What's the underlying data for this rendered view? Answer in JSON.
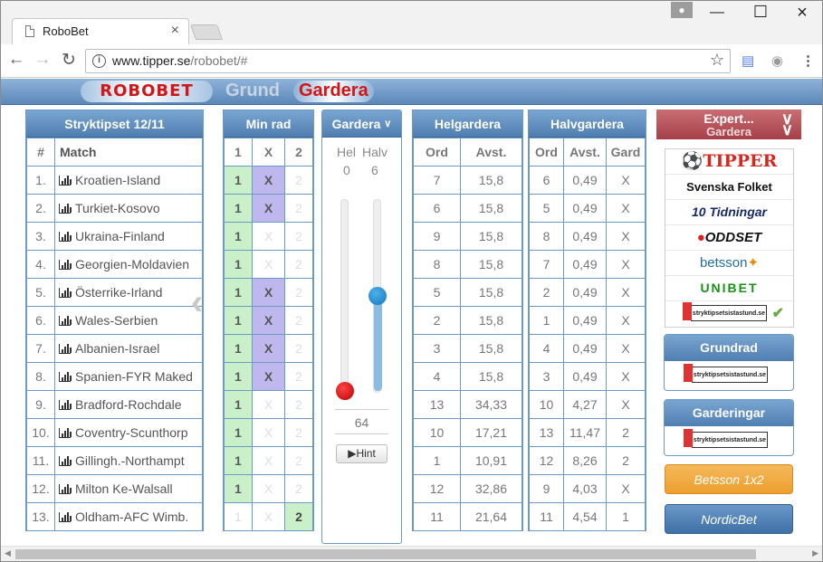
{
  "browser": {
    "tab_title": "RoboBet",
    "url_host": "www.tipper.se",
    "url_path": "/robobet/#"
  },
  "appnav": {
    "logo": "ROBOBET",
    "grund": "Grund",
    "gardera": "Gardera"
  },
  "matches": {
    "title": "Stryktipset 12/11",
    "col_num": "#",
    "col_match": "Match",
    "rows": [
      {
        "n": "1.",
        "name": "Kroatien-Island"
      },
      {
        "n": "2.",
        "name": "Turkiet-Kosovo"
      },
      {
        "n": "3.",
        "name": "Ukraina-Finland"
      },
      {
        "n": "4.",
        "name": "Georgien-Moldavien"
      },
      {
        "n": "5.",
        "name": "Österrike-Irland"
      },
      {
        "n": "6.",
        "name": "Wales-Serbien"
      },
      {
        "n": "7.",
        "name": "Albanien-Israel"
      },
      {
        "n": "8.",
        "name": "Spanien-FYR Maked"
      },
      {
        "n": "9.",
        "name": "Bradford-Rochdale"
      },
      {
        "n": "10.",
        "name": "Coventry-Scunthorp"
      },
      {
        "n": "11.",
        "name": "Gillingh.-Northampt"
      },
      {
        "n": "12.",
        "name": "Milton Ke-Walsall"
      },
      {
        "n": "13.",
        "name": "Oldham-AFC Wimb."
      }
    ]
  },
  "minrad": {
    "title": "Min rad",
    "cols": [
      "1",
      "X",
      "2"
    ],
    "rows": [
      [
        "1",
        "X",
        "2"
      ],
      [
        "1",
        "X",
        "2"
      ],
      [
        "1",
        "X",
        "2"
      ],
      [
        "1",
        "X",
        "2"
      ],
      [
        "1",
        "X",
        "2"
      ],
      [
        "1",
        "X",
        "2"
      ],
      [
        "1",
        "X",
        "2"
      ],
      [
        "1",
        "X",
        "2"
      ],
      [
        "1",
        "X",
        "2"
      ],
      [
        "1",
        "X",
        "2"
      ],
      [
        "1",
        "X",
        "2"
      ],
      [
        "1",
        "X",
        "2"
      ],
      [
        "1",
        "X",
        "2"
      ]
    ],
    "selected": [
      [
        true,
        true,
        false
      ],
      [
        true,
        true,
        false
      ],
      [
        true,
        false,
        false
      ],
      [
        true,
        false,
        false
      ],
      [
        true,
        true,
        false
      ],
      [
        true,
        true,
        false
      ],
      [
        true,
        true,
        false
      ],
      [
        true,
        true,
        false
      ],
      [
        true,
        false,
        false
      ],
      [
        true,
        false,
        false
      ],
      [
        true,
        false,
        false
      ],
      [
        true,
        false,
        false
      ],
      [
        false,
        false,
        true
      ]
    ]
  },
  "gardera": {
    "title": "Gardera",
    "hel_label": "Hel",
    "halv_label": "Halv",
    "hel_value": "0",
    "halv_value": "6",
    "rows_count": "64",
    "hint_label": "Hint",
    "hel_level": 0.0,
    "halv_level": 0.5
  },
  "helgardera": {
    "title": "Helgardera",
    "col_ord": "Ord",
    "col_avst": "Avst.",
    "rows": [
      [
        "7",
        "15,8"
      ],
      [
        "6",
        "15,8"
      ],
      [
        "9",
        "15,8"
      ],
      [
        "8",
        "15,8"
      ],
      [
        "5",
        "15,8"
      ],
      [
        "2",
        "15,8"
      ],
      [
        "3",
        "15,8"
      ],
      [
        "4",
        "15,8"
      ],
      [
        "13",
        "34,33"
      ],
      [
        "10",
        "17,21"
      ],
      [
        "1",
        "10,91"
      ],
      [
        "12",
        "32,86"
      ],
      [
        "11",
        "21,64"
      ]
    ]
  },
  "halvgardera": {
    "title": "Halvgardera",
    "col_ord": "Ord",
    "col_avst": "Avst.",
    "col_gard": "Gard",
    "rows": [
      [
        "6",
        "0,49",
        "X"
      ],
      [
        "5",
        "0,49",
        "X"
      ],
      [
        "8",
        "0,49",
        "X"
      ],
      [
        "7",
        "0,49",
        "X"
      ],
      [
        "2",
        "0,49",
        "X"
      ],
      [
        "1",
        "0,49",
        "X"
      ],
      [
        "4",
        "0,49",
        "X"
      ],
      [
        "3",
        "0,49",
        "X"
      ],
      [
        "10",
        "4,27",
        "X"
      ],
      [
        "13",
        "11,47",
        "2"
      ],
      [
        "12",
        "8,26",
        "2"
      ],
      [
        "9",
        "4,03",
        "X"
      ],
      [
        "11",
        "4,54",
        "1"
      ]
    ]
  },
  "expert": {
    "line1": "Expert...",
    "line2": "Gardera",
    "brands": [
      "TIPPER",
      "Svenska Folket",
      "10 Tidningar",
      "ODDSET",
      "betsson",
      "UNIBET",
      "stryktipsetsistastund.se"
    ]
  },
  "sidebar": {
    "grundrad": "Grundrad",
    "garderingar": "Garderingar",
    "badge": "stryktipsetsistastund.se",
    "betsson_btn": "Betsson 1x2",
    "nordicbet_btn": "NordicBet"
  },
  "colors": {
    "header_blue": "#5b88b9",
    "select_green": "#c9f0c9",
    "select_purple": "#bfb8ef",
    "expert_red": "#a73f48",
    "betsson_orange": "#f0aa3c",
    "nordic_blue": "#4d7fb5"
  }
}
